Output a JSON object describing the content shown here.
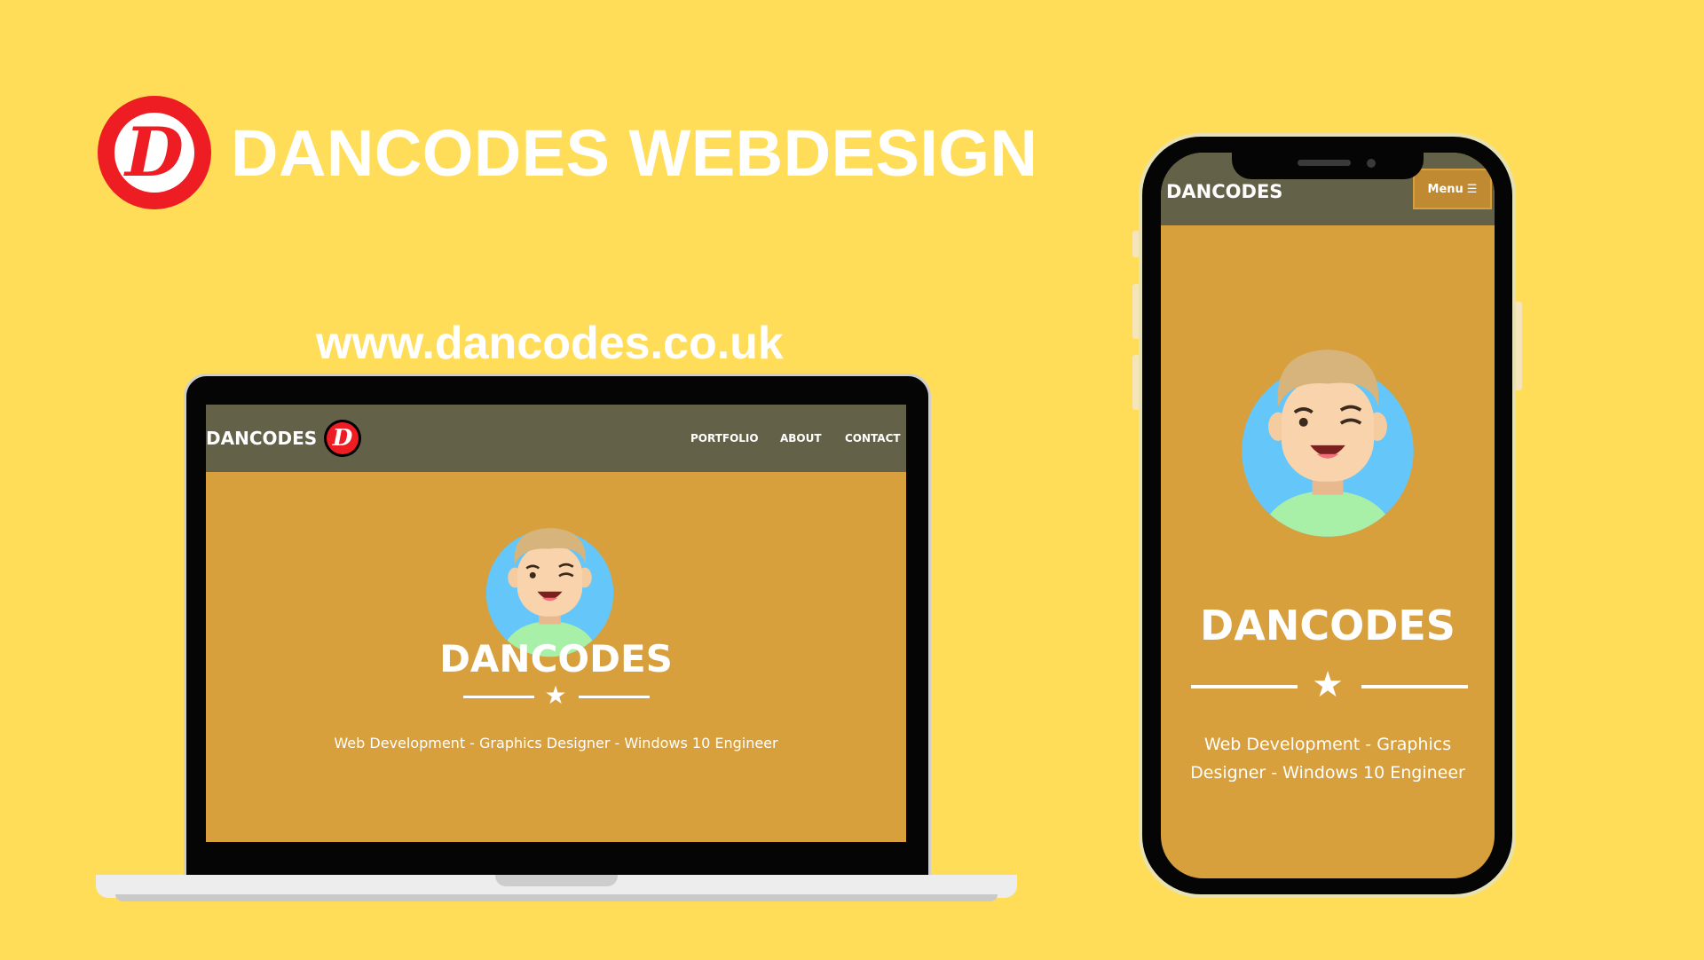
{
  "brand": {
    "logo_letter": "D",
    "title": "DANCODES WEBDESIGN"
  },
  "url": "www.dancodes.co.uk",
  "laptop_site": {
    "nav": {
      "logo_text": "DANCODES",
      "logo_letter": "D",
      "links": [
        "PORTFOLIO",
        "ABOUT",
        "CONTACT"
      ]
    },
    "hero": {
      "title": "DANCODES",
      "star": "★",
      "subtitle": "Web Development - Graphics Designer - Windows 10 Engineer"
    }
  },
  "phone_site": {
    "nav": {
      "logo_text": "DANCODES",
      "menu_label": "Menu",
      "menu_icon": "☰"
    },
    "hero": {
      "title": "DANCODES",
      "star": "★",
      "subtitle_line1": "Web Development - Graphics",
      "subtitle_line2": "Designer - Windows 10 Engineer"
    }
  },
  "icons": {
    "brand_logo": "d-logo-icon",
    "avatar": "avatar-icon",
    "star": "star-icon",
    "menu": "hamburger-icon"
  },
  "colors": {
    "background": "#FFDD59",
    "site_orange": "#D89F3D",
    "nav_olive": "#636147",
    "logo_red": "#EE1D23",
    "avatar_blue": "#64C6F9",
    "shirt_green": "#A8F0A8"
  }
}
